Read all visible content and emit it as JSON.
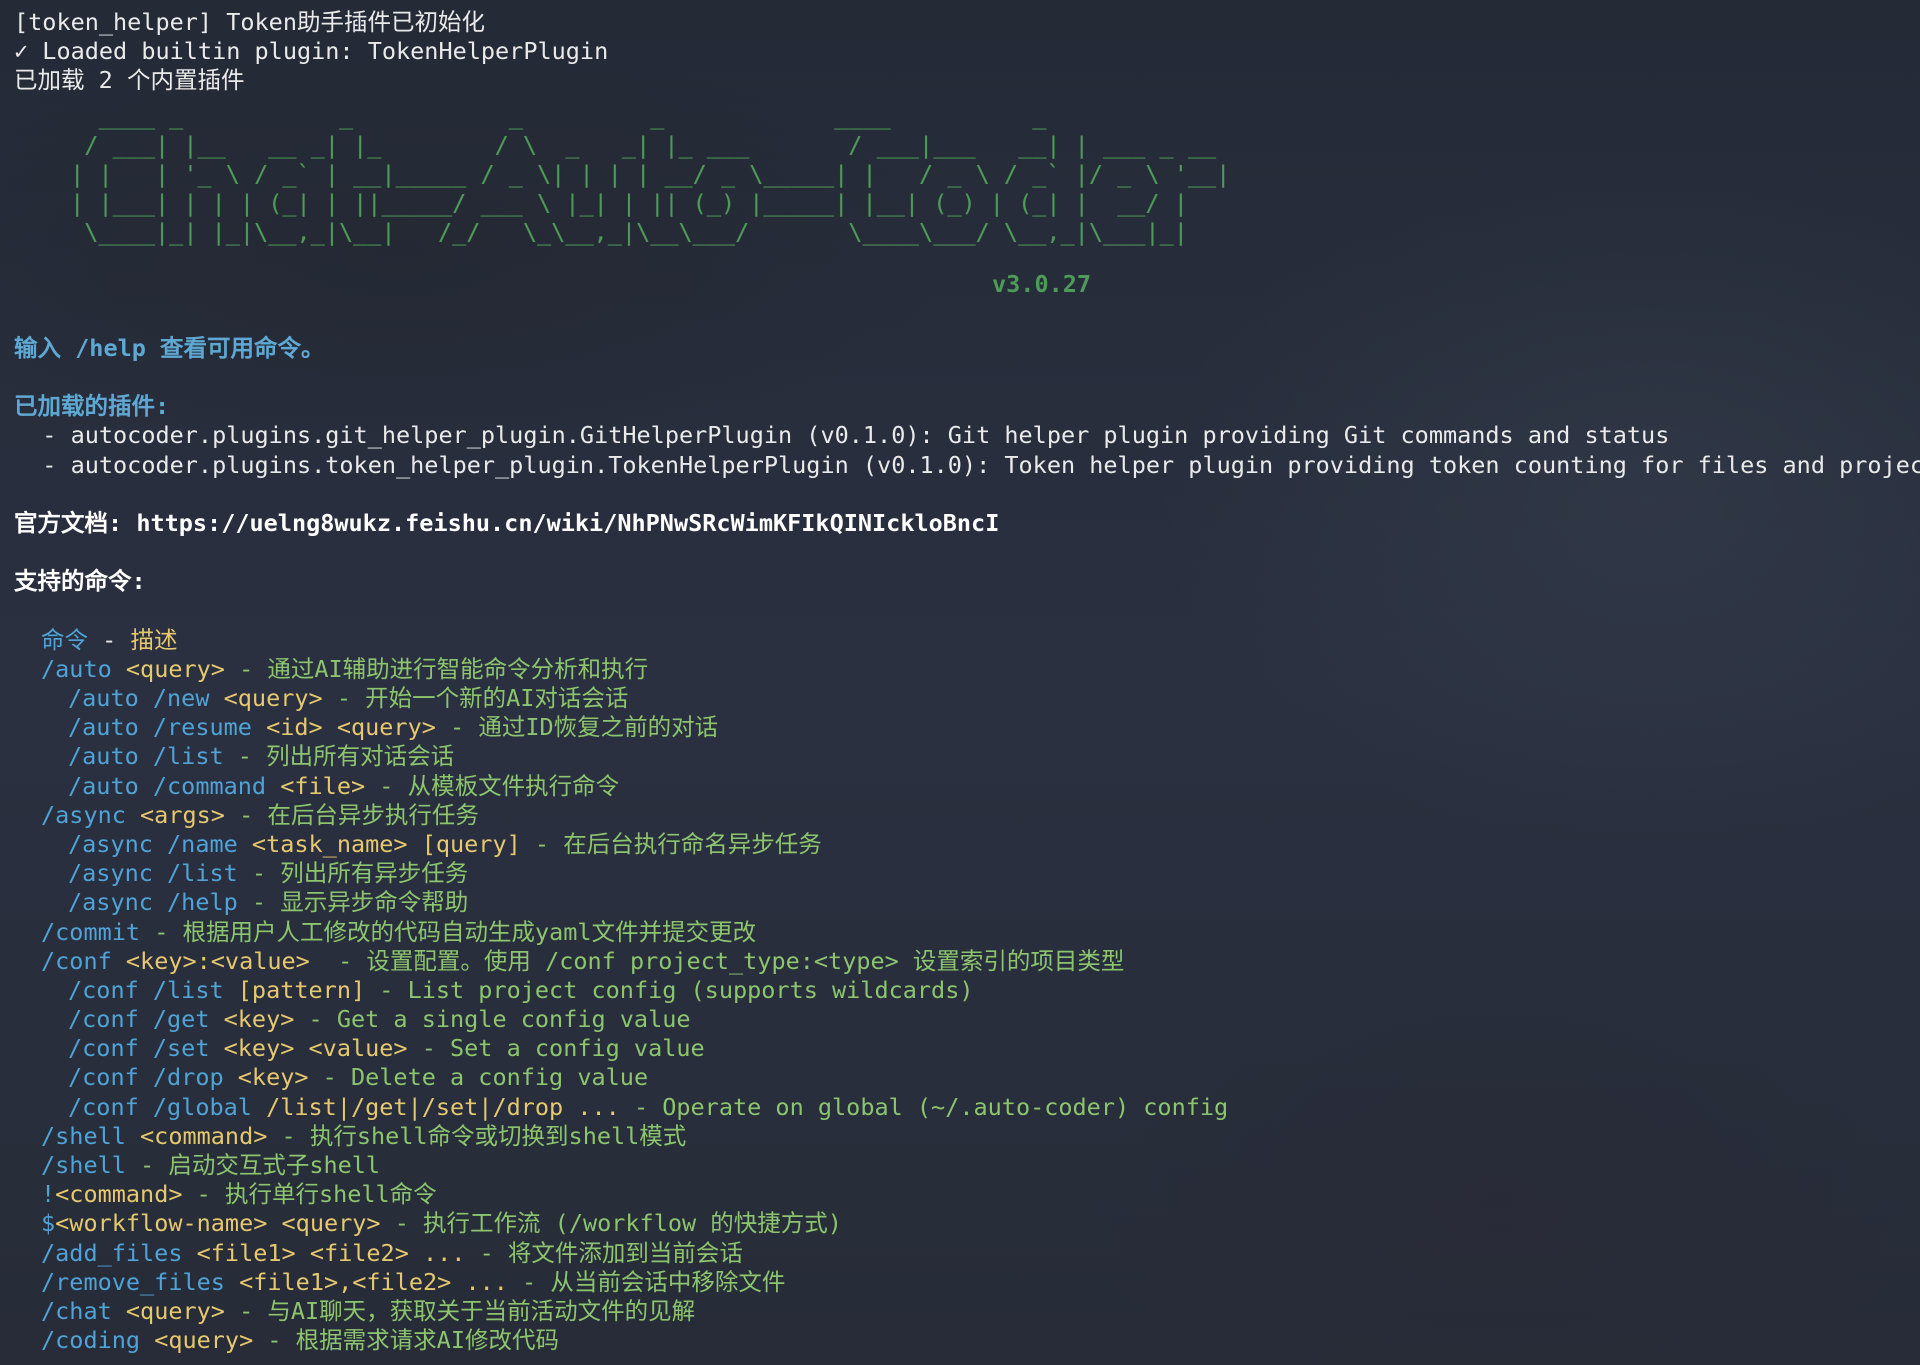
{
  "boot": {
    "line1": "[token_helper] Token助手插件已初始化",
    "line2": "✓ Loaded builtin plugin: TokenHelperPlugin",
    "line3": "已加载 2 个内置插件"
  },
  "banner": {
    "ascii": "   ____ _           _           _         _            ____          _\n  / ___| |__   __ _| |_        / \\  _   _| |_ ___       / ___|___   __| | ___ _ __\n | |   | '_ \\ / _` | __|_____ / _ \\| | | | __/ _ \\_____| |   / _ \\ / _` |/ _ \\ '__|\n | |___| | | | (_| | ||_____/ ___ \\ |_| | || (_) |_____| |__| (_) | (_| |  __/ |\n  \\____|_| |_|\\__,_|\\__|   /_/   \\_\\__,_|\\__\\___/       \\____\\___/ \\__,_|\\___|_|",
    "version": "v3.0.27"
  },
  "help_hint": "输入 /help 查看可用命令。",
  "plugins": {
    "heading": "已加载的插件:",
    "items": [
      "  - autocoder.plugins.git_helper_plugin.GitHelperPlugin (v0.1.0): Git helper plugin providing Git commands and status",
      "  - autocoder.plugins.token_helper_plugin.TokenHelperPlugin (v0.1.0): Token helper plugin providing token counting for files and projects"
    ]
  },
  "docs": {
    "label": "官方文档:",
    "url": "https://uelng8wukz.feishu.cn/wiki/NhPNwSRcWimKFIkQINIckloBncI"
  },
  "commands": {
    "heading": "支持的命令:",
    "header": {
      "cmd": "命令",
      "sep": " - ",
      "desc": "描述"
    },
    "rows": [
      {
        "level": 1,
        "cmd": "/auto",
        "args": " <query>",
        "desc": " - 通过AI辅助进行智能命令分析和执行"
      },
      {
        "level": 2,
        "cmd": "/auto /new",
        "args": " <query>",
        "desc": " - 开始一个新的AI对话会话"
      },
      {
        "level": 2,
        "cmd": "/auto /resume",
        "args": " <id> <query>",
        "desc": " - 通过ID恢复之前的对话"
      },
      {
        "level": 2,
        "cmd": "/auto /list",
        "args": "",
        "desc": " - 列出所有对话会话"
      },
      {
        "level": 2,
        "cmd": "/auto /command",
        "args": " <file>",
        "desc": " - 从模板文件执行命令"
      },
      {
        "level": 1,
        "cmd": "/async",
        "args": " <args>",
        "desc": " - 在后台异步执行任务"
      },
      {
        "level": 2,
        "cmd": "/async /name",
        "args": " <task_name> [query]",
        "desc": " - 在后台执行命名异步任务"
      },
      {
        "level": 2,
        "cmd": "/async /list",
        "args": "",
        "desc": " - 列出所有异步任务"
      },
      {
        "level": 2,
        "cmd": "/async /help",
        "args": "",
        "desc": " - 显示异步命令帮助"
      },
      {
        "level": 1,
        "cmd": "/commit",
        "args": "",
        "desc": " - 根据用户人工修改的代码自动生成yaml文件并提交更改"
      },
      {
        "level": 1,
        "cmd": "/conf",
        "args": " <key>:<value> ",
        "desc": " - 设置配置。使用 /conf project_type:<type> 设置索引的项目类型"
      },
      {
        "level": 2,
        "cmd": "/conf /list",
        "args": " [pattern]",
        "desc": " - List project config (supports wildcards)"
      },
      {
        "level": 2,
        "cmd": "/conf /get",
        "args": " <key>",
        "desc": " - Get a single config value"
      },
      {
        "level": 2,
        "cmd": "/conf /set",
        "args": " <key> <value>",
        "desc": " - Set a config value"
      },
      {
        "level": 2,
        "cmd": "/conf /drop",
        "args": " <key>",
        "desc": " - Delete a config value"
      },
      {
        "level": 2,
        "cmd": "/conf /global",
        "args": " /list|/get|/set|/drop ...",
        "desc": " - Operate on global (~/.auto-coder) config"
      },
      {
        "level": 1,
        "cmd": "/shell",
        "args": " <command>",
        "desc": " - 执行shell命令或切换到shell模式"
      },
      {
        "level": 1,
        "cmd": "/shell",
        "args": "",
        "desc": " - 启动交互式子shell"
      },
      {
        "level": 1,
        "cmd": "!",
        "args": "<command>",
        "desc": " - 执行单行shell命令"
      },
      {
        "level": 1,
        "cmd": "$",
        "args": "<workflow-name> <query>",
        "desc": " - 执行工作流 (/workflow 的快捷方式)"
      },
      {
        "level": 1,
        "cmd": "/add_files",
        "args": " <file1> <file2> ...",
        "desc": " - 将文件添加到当前会话"
      },
      {
        "level": 1,
        "cmd": "/remove_files",
        "args": " <file1>,<file2> ...",
        "desc": " - 从当前会话中移除文件"
      },
      {
        "level": 1,
        "cmd": "/chat",
        "args": " <query>",
        "desc": " - 与AI聊天，获取关于当前活动文件的见解"
      },
      {
        "level": 1,
        "cmd": "/coding",
        "args": " <query>",
        "desc": " - 根据需求请求AI修改代码"
      }
    ]
  },
  "colors": {
    "background": "#262b38",
    "command": "#4fa3d6",
    "argument": "#e6c86e",
    "description": "#8cc56e",
    "banner": "#4e9a58",
    "heading": "#5fa8d3"
  }
}
